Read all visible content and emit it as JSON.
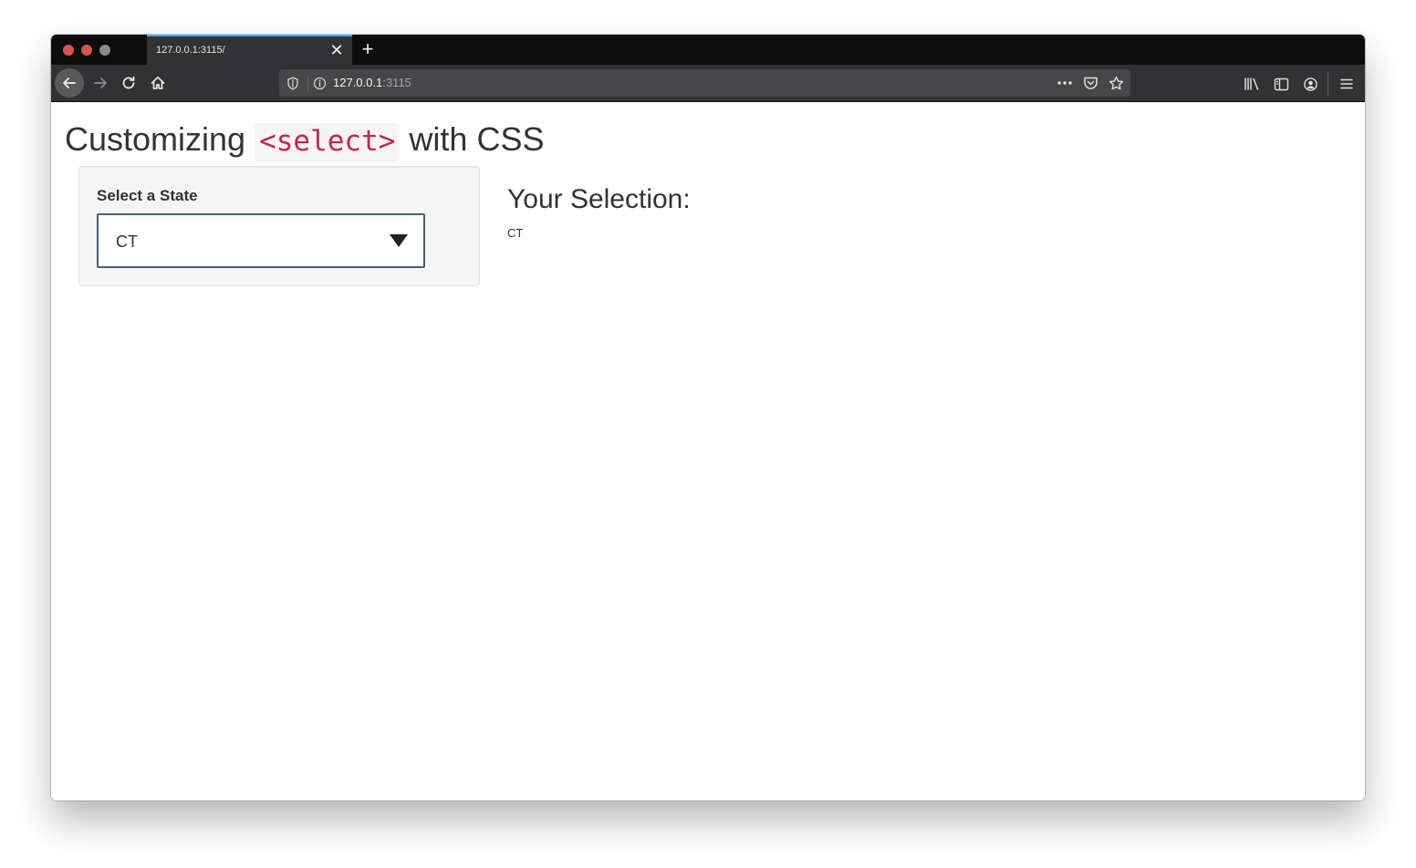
{
  "browser": {
    "tab": {
      "title": "127.0.0.1:3115/"
    },
    "url": {
      "host": "127.0.0.1",
      "port": ":3115"
    },
    "icons": {
      "close_tab": "close-icon",
      "new_tab": "plus-icon",
      "back": "arrow-left-icon",
      "forward": "arrow-right-icon",
      "reload": "reload-icon",
      "home": "home-icon",
      "shield": "shield-icon",
      "info": "info-icon",
      "more": "more-icon",
      "pocket": "pocket-icon",
      "bookmark": "star-icon",
      "library": "library-icon",
      "sidebar": "sidebar-icon",
      "account": "account-icon",
      "menu": "hamburger-menu-icon"
    },
    "tab_text": {
      "close": "✕",
      "new": "+"
    },
    "colors": {
      "tab_accent": "#4aa6ff",
      "chrome": "#323234",
      "tabbar": "#0c0c0d"
    }
  },
  "page": {
    "title_prefix": "Customizing",
    "title_code": "<select>",
    "title_suffix": "with CSS",
    "colors": {
      "code": "#c7254e",
      "select_border": "#4b5d78"
    },
    "select": {
      "label": "Select a State",
      "value": "CT"
    },
    "result": {
      "title": "Your Selection:",
      "value": "CT"
    }
  }
}
